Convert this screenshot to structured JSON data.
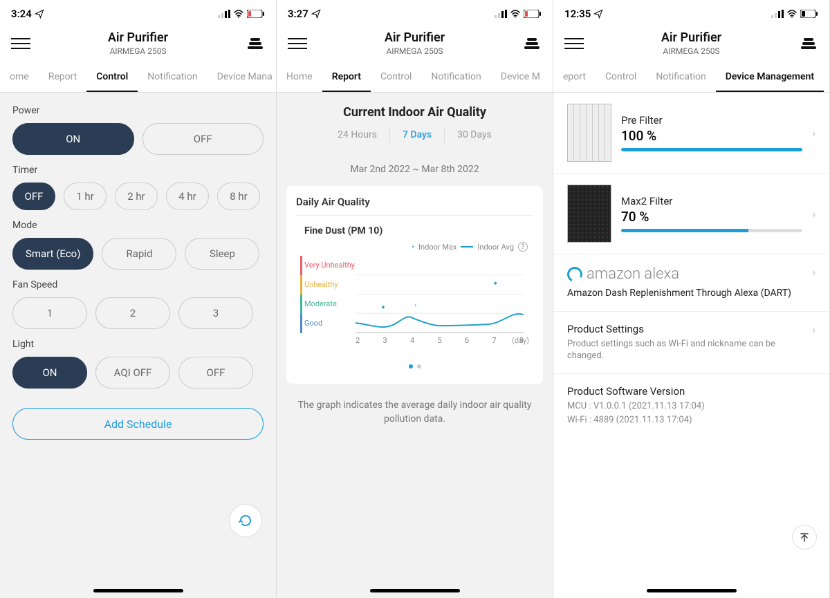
{
  "statusbar": {
    "time1": "3:24",
    "time2": "3:27",
    "time3": "12:35"
  },
  "header": {
    "title": "Air Purifier",
    "subtitle": "AIRMEGA 250S"
  },
  "tabs": {
    "home": "Home",
    "report": "Report",
    "control": "Control",
    "notification": "Notification",
    "device": "Device Management",
    "device_trunc1": "Device Mana",
    "home_trunc1": "ome",
    "device_trunc2": "Device M",
    "report_trunc3": "eport"
  },
  "control": {
    "power_label": "Power",
    "on": "ON",
    "off": "OFF",
    "timer_label": "Timer",
    "timer_opts": [
      "OFF",
      "1 hr",
      "2 hr",
      "4 hr",
      "8 hr"
    ],
    "mode_label": "Mode",
    "mode_opts": [
      "Smart (Eco)",
      "Rapid",
      "Sleep"
    ],
    "fan_label": "Fan Speed",
    "fan_opts": [
      "1",
      "2",
      "3"
    ],
    "light_label": "Light",
    "light_opts": [
      "ON",
      "AQI OFF",
      "OFF"
    ],
    "add_schedule": "Add Schedule"
  },
  "report": {
    "title": "Current Indoor Air Quality",
    "periods": [
      "24 Hours",
      "7 Days",
      "30 Days"
    ],
    "daterange": "Mar 2nd 2022 ~ Mar 8th 2022",
    "card_title": "Daily Air Quality",
    "metric": "Fine Dust (PM 10)",
    "legend_max": "Indoor Max",
    "legend_avg": "Indoor Avg",
    "ylabels": [
      "Very Unhealthy",
      "Unhealthy",
      "Moderate",
      "Good"
    ],
    "xunit": "(day)",
    "note": "The graph indicates the average daily indoor air quality pollution data."
  },
  "chart_data": {
    "type": "line",
    "title": "Daily Air Quality – Fine Dust (PM 10)",
    "xlabel": "(day)",
    "ylabel": "",
    "y_categories": [
      "Good",
      "Moderate",
      "Unhealthy",
      "Very Unhealthy"
    ],
    "x": [
      2,
      3,
      4,
      5,
      6,
      7,
      8
    ],
    "series": [
      {
        "name": "Indoor Max",
        "values": [
          null,
          1.3,
          null,
          null,
          null,
          2.6,
          null
        ]
      },
      {
        "name": "Indoor Avg",
        "values": [
          0.5,
          0.3,
          0.8,
          0.4,
          0.35,
          0.4,
          0.9
        ]
      }
    ],
    "ylim": [
      0,
      4
    ]
  },
  "dm": {
    "filters": [
      {
        "name": "Pre Filter",
        "pct_text": "100 %",
        "pct": 100
      },
      {
        "name": "Max2 Filter",
        "pct_text": "70 %",
        "pct": 70
      }
    ],
    "alexa_brand": "amazon alexa",
    "alexa_sub": "Amazon Dash Replenishment Through Alexa (DART)",
    "settings_title": "Product Settings",
    "settings_sub": "Product settings such as Wi-Fi and nickname can be changed.",
    "sw_title": "Product Software Version",
    "sw_mcu": "MCU : V1.0.0.1 (2021.11.13 17:04)",
    "sw_wifi": "Wi-Fi : 4889 (2021.11.13 17:04)"
  }
}
